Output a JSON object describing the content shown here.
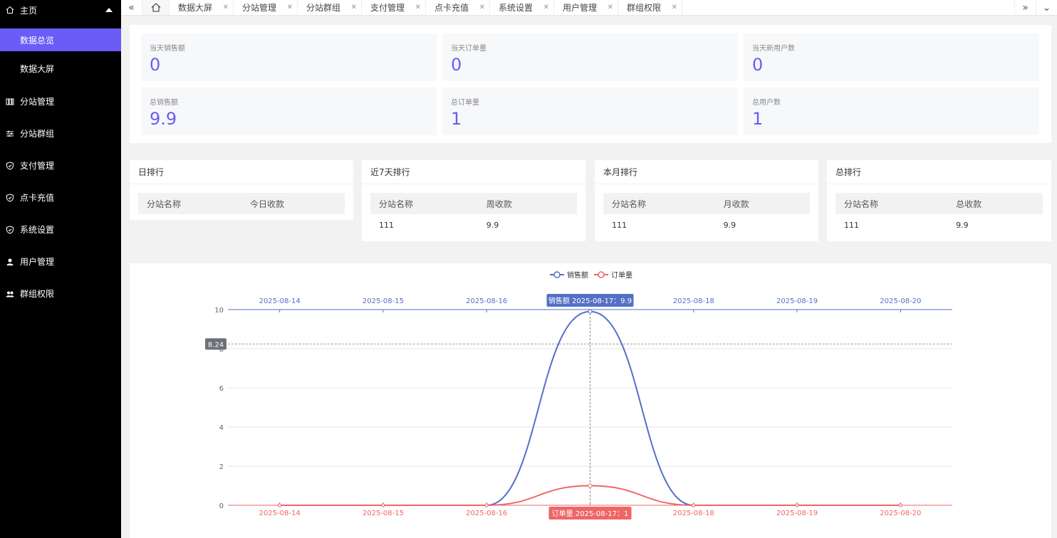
{
  "sidebar": {
    "home": "主页",
    "subs": [
      "数据总览",
      "数据大屏"
    ],
    "items": [
      {
        "label": "分站管理",
        "icon": "columns-icon"
      },
      {
        "label": "分站群组",
        "icon": "sliders-icon"
      },
      {
        "label": "支付管理",
        "icon": "shield-icon"
      },
      {
        "label": "点卡充值",
        "icon": "shield-icon"
      },
      {
        "label": "系统设置",
        "icon": "shield-icon"
      },
      {
        "label": "用户管理",
        "icon": "user-icon"
      },
      {
        "label": "群组权限",
        "icon": "users-icon"
      }
    ]
  },
  "tabs": [
    "数据大屏",
    "分站管理",
    "分站群组",
    "支付管理",
    "点卡充值",
    "系统设置",
    "用户管理",
    "群组权限"
  ],
  "stats": [
    {
      "label": "当天销售额",
      "value": "0"
    },
    {
      "label": "当天订单量",
      "value": "0"
    },
    {
      "label": "当天新用户数",
      "value": "0"
    },
    {
      "label": "总销售额",
      "value": "9.9"
    },
    {
      "label": "总订单量",
      "value": "1"
    },
    {
      "label": "总用户数",
      "value": "1"
    }
  ],
  "rankings": [
    {
      "title": "日排行",
      "col1": "分站名称",
      "col2": "今日收款",
      "rows": []
    },
    {
      "title": "近7天排行",
      "col1": "分站名称",
      "col2": "周收款",
      "rows": [
        [
          "111",
          "9.9"
        ]
      ]
    },
    {
      "title": "本月排行",
      "col1": "分站名称",
      "col2": "月收款",
      "rows": [
        [
          "111",
          "9.9"
        ]
      ]
    },
    {
      "title": "总排行",
      "col1": "分站名称",
      "col2": "总收款",
      "rows": [
        [
          "111",
          "9.9"
        ]
      ]
    }
  ],
  "colors": {
    "accent": "#6a5cf6",
    "sales": "#5470c6",
    "orders": "#ee6666"
  },
  "chart_data": {
    "type": "line",
    "x": [
      "2025-08-14",
      "2025-08-15",
      "2025-08-16",
      "2025-08-17",
      "2025-08-18",
      "2025-08-19",
      "2025-08-20"
    ],
    "series": [
      {
        "name": "销售额",
        "values": [
          0,
          0,
          0,
          9.9,
          0,
          0,
          0
        ],
        "color": "#5470c6"
      },
      {
        "name": "订单量",
        "values": [
          0,
          0,
          0,
          1,
          0,
          0,
          0
        ],
        "color": "#ee6666"
      }
    ],
    "yticks": [
      0,
      2,
      4,
      6,
      8,
      10
    ],
    "ylim": [
      0,
      10
    ],
    "legend": "top-center",
    "smooth": true,
    "tooltip": {
      "sales": "销售额  2025-08-17：9.9",
      "orders": "订单量  2025-08-17：1",
      "y_pointer": "8.24"
    }
  }
}
